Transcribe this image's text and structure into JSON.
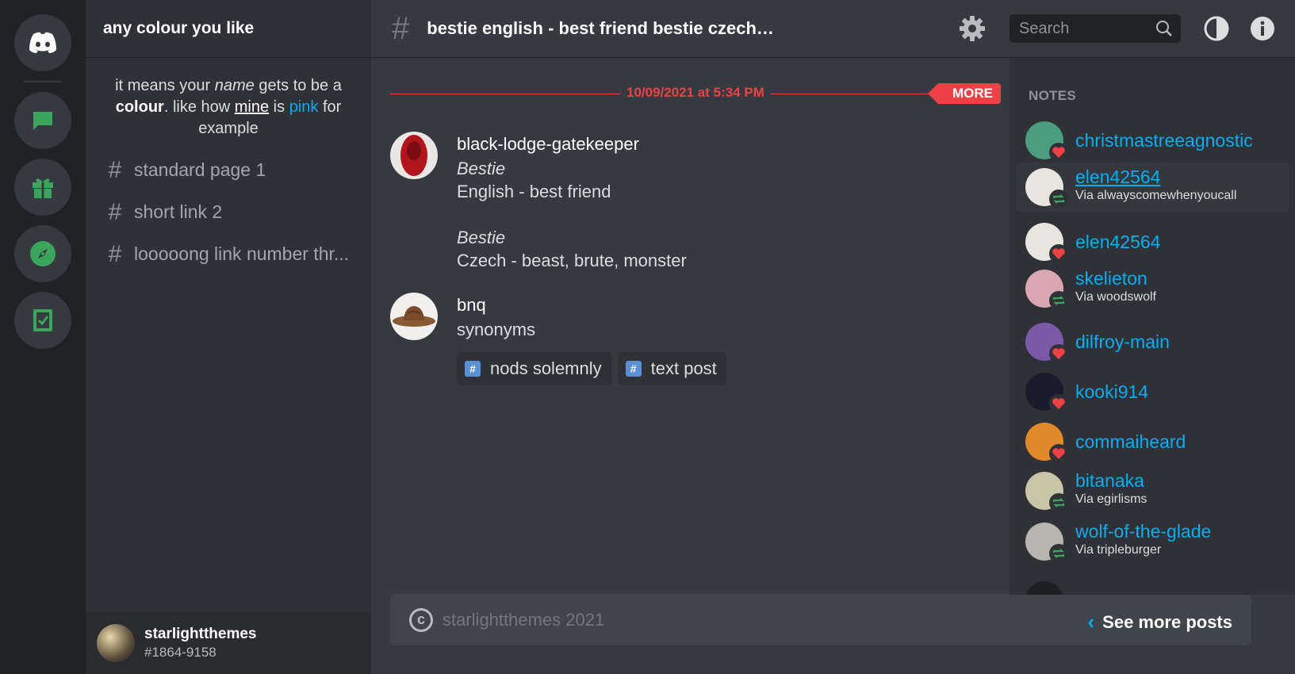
{
  "server_rail": {
    "items": [
      "discord-home",
      "chat",
      "gift",
      "explore",
      "book"
    ]
  },
  "sidebar": {
    "title": "any colour you like",
    "desc": {
      "p1": "it means your ",
      "name": "name",
      "p2": " gets to be a ",
      "colour": "colour",
      "p3": ". like how ",
      "mine": "mine",
      "p4": " is ",
      "pink": "pink",
      "p5": " for example"
    },
    "channels": [
      "standard page 1",
      "short link 2",
      "looooong link number thr..."
    ],
    "user": {
      "name": "starlightthemes",
      "tag": "#1864-9158"
    }
  },
  "topbar": {
    "hash": "#",
    "title": "bestie english - best friend bestie czech -...",
    "search_placeholder": "Search"
  },
  "chat": {
    "date": "10/09/2021 at 5:34 PM",
    "more": "MORE",
    "messages": [
      {
        "author": "black-lodge-gatekeeper",
        "lines": [
          "Bestie",
          "English - best friend",
          "",
          "Bestie",
          "Czech - beast, brute, monster"
        ]
      },
      {
        "author": "bnq",
        "lines": [
          "synonyms"
        ],
        "tags": [
          "nods solemnly",
          "text post"
        ]
      }
    ]
  },
  "footer": {
    "copyright": "starlightthemes 2021",
    "see_more": "See more posts"
  },
  "notes": {
    "header": "NOTES",
    "items": [
      {
        "name": "christmastreeagnostic",
        "via": "",
        "type": "like",
        "color": "#4a9d7e"
      },
      {
        "name": "elen42564",
        "via": "Via alwayscomewhenyoucall",
        "type": "reblog",
        "color": "#e8e4de"
      },
      {
        "name": "elen42564",
        "via": "",
        "type": "like",
        "color": "#e8e4de"
      },
      {
        "name": "skelieton",
        "via": "Via woodswolf",
        "type": "reblog",
        "color": "#d9a7b0"
      },
      {
        "name": "dilfroy-main",
        "via": "",
        "type": "like",
        "color": "#7a5aa8"
      },
      {
        "name": "kooki914",
        "via": "",
        "type": "like",
        "color": "#1b1b2e"
      },
      {
        "name": "commaiheard",
        "via": "",
        "type": "like",
        "color": "#e08a2c"
      },
      {
        "name": "bitanaka",
        "via": "Via egirlisms",
        "type": "reblog",
        "color": "#c9c4a8"
      },
      {
        "name": "wolf-of-the-glade",
        "via": "Via tripleburger",
        "type": "reblog",
        "color": "#b8b4ae"
      }
    ]
  },
  "colors": {
    "accent_red": "#ed4245",
    "link_blue": "#00aff4",
    "green_icon": "#3ba55d"
  }
}
